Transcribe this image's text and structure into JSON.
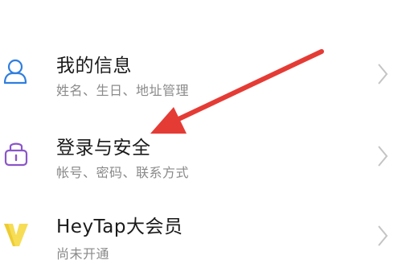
{
  "settings": {
    "items": [
      {
        "title": "我的信息",
        "subtitle": "姓名、生日、地址管理",
        "icon": "person-icon",
        "icon_color": "#2f7ee0"
      },
      {
        "title": "登录与安全",
        "subtitle": "帐号、密码、联系方式",
        "icon": "lock-icon",
        "icon_color": "#8a56c8"
      },
      {
        "title": "HeyTap大会员",
        "subtitle": "尚未开通",
        "icon": "heytap-v-icon",
        "icon_color": "#e8c21a"
      }
    ]
  },
  "annotation": {
    "arrow_color": "#e53b35"
  }
}
